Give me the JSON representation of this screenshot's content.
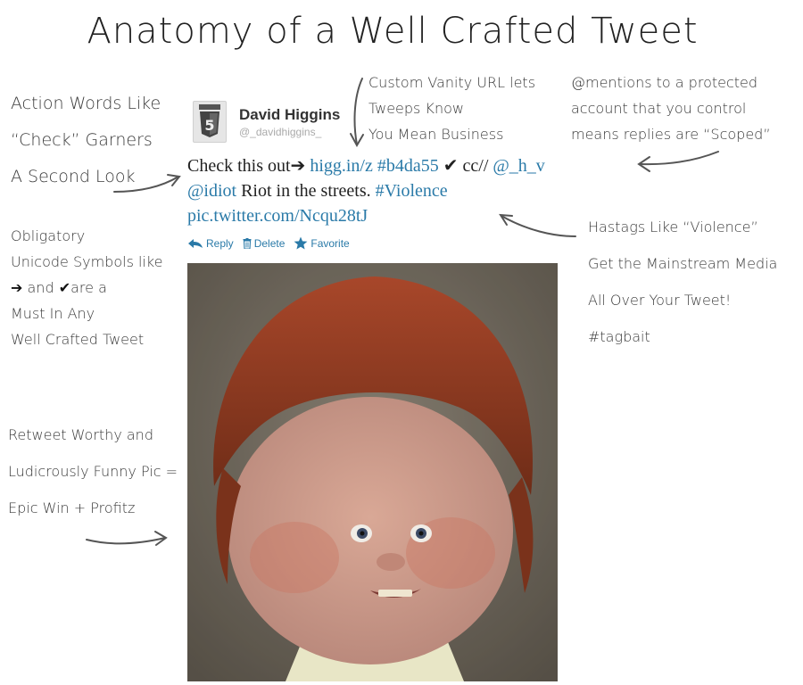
{
  "title": "Anatomy of a Well Crafted Tweet",
  "annotations": {
    "action_words": [
      "Action Words Like",
      "“Check” Garners",
      "A Second Look"
    ],
    "unicode_symbols": {
      "line1": "Obligatory",
      "line2": "Unicode Symbols like",
      "line3_and": "and",
      "line3_rest": "are a",
      "line4": "Must In Any",
      "line5": "Well Crafted Tweet"
    },
    "retweet_pic": [
      "Retweet Worthy and",
      "Ludicrously Funny Pic =",
      "Epic Win + Profitz"
    ],
    "vanity_url": [
      "Custom Vanity URL lets",
      "Tweeps Know",
      "You Mean Business"
    ],
    "mentions": [
      "@mentions to a protected",
      "account that you control",
      "means replies are “Scoped”"
    ],
    "hashtags": [
      "Hastags Like “Violence”",
      "Get the Mainstream Media",
      "All Over Your Tweet!",
      "#tagbait"
    ]
  },
  "tweet": {
    "author_name": "David Higgins",
    "author_handle": "@_davidhiggins_",
    "avatar_icon": "html5-shield-icon",
    "text": {
      "check": "Check this out",
      "arrow": "➔",
      "short_url": "higg.in/z",
      "hash_code": "#b4da55",
      "checkmark": "✔",
      "cc": "cc//",
      "mention_hv": "@_h_v",
      "mention_idiot": "@idiot",
      "riot": "Riot in the streets.",
      "hashtag": "#Violence",
      "pic_link": "pic.twitter.com/Ncqu28tJ"
    },
    "actions": {
      "reply": "Reply",
      "delete": "Delete",
      "favorite": "Favorite"
    },
    "link_color": "#2a7aa8"
  }
}
